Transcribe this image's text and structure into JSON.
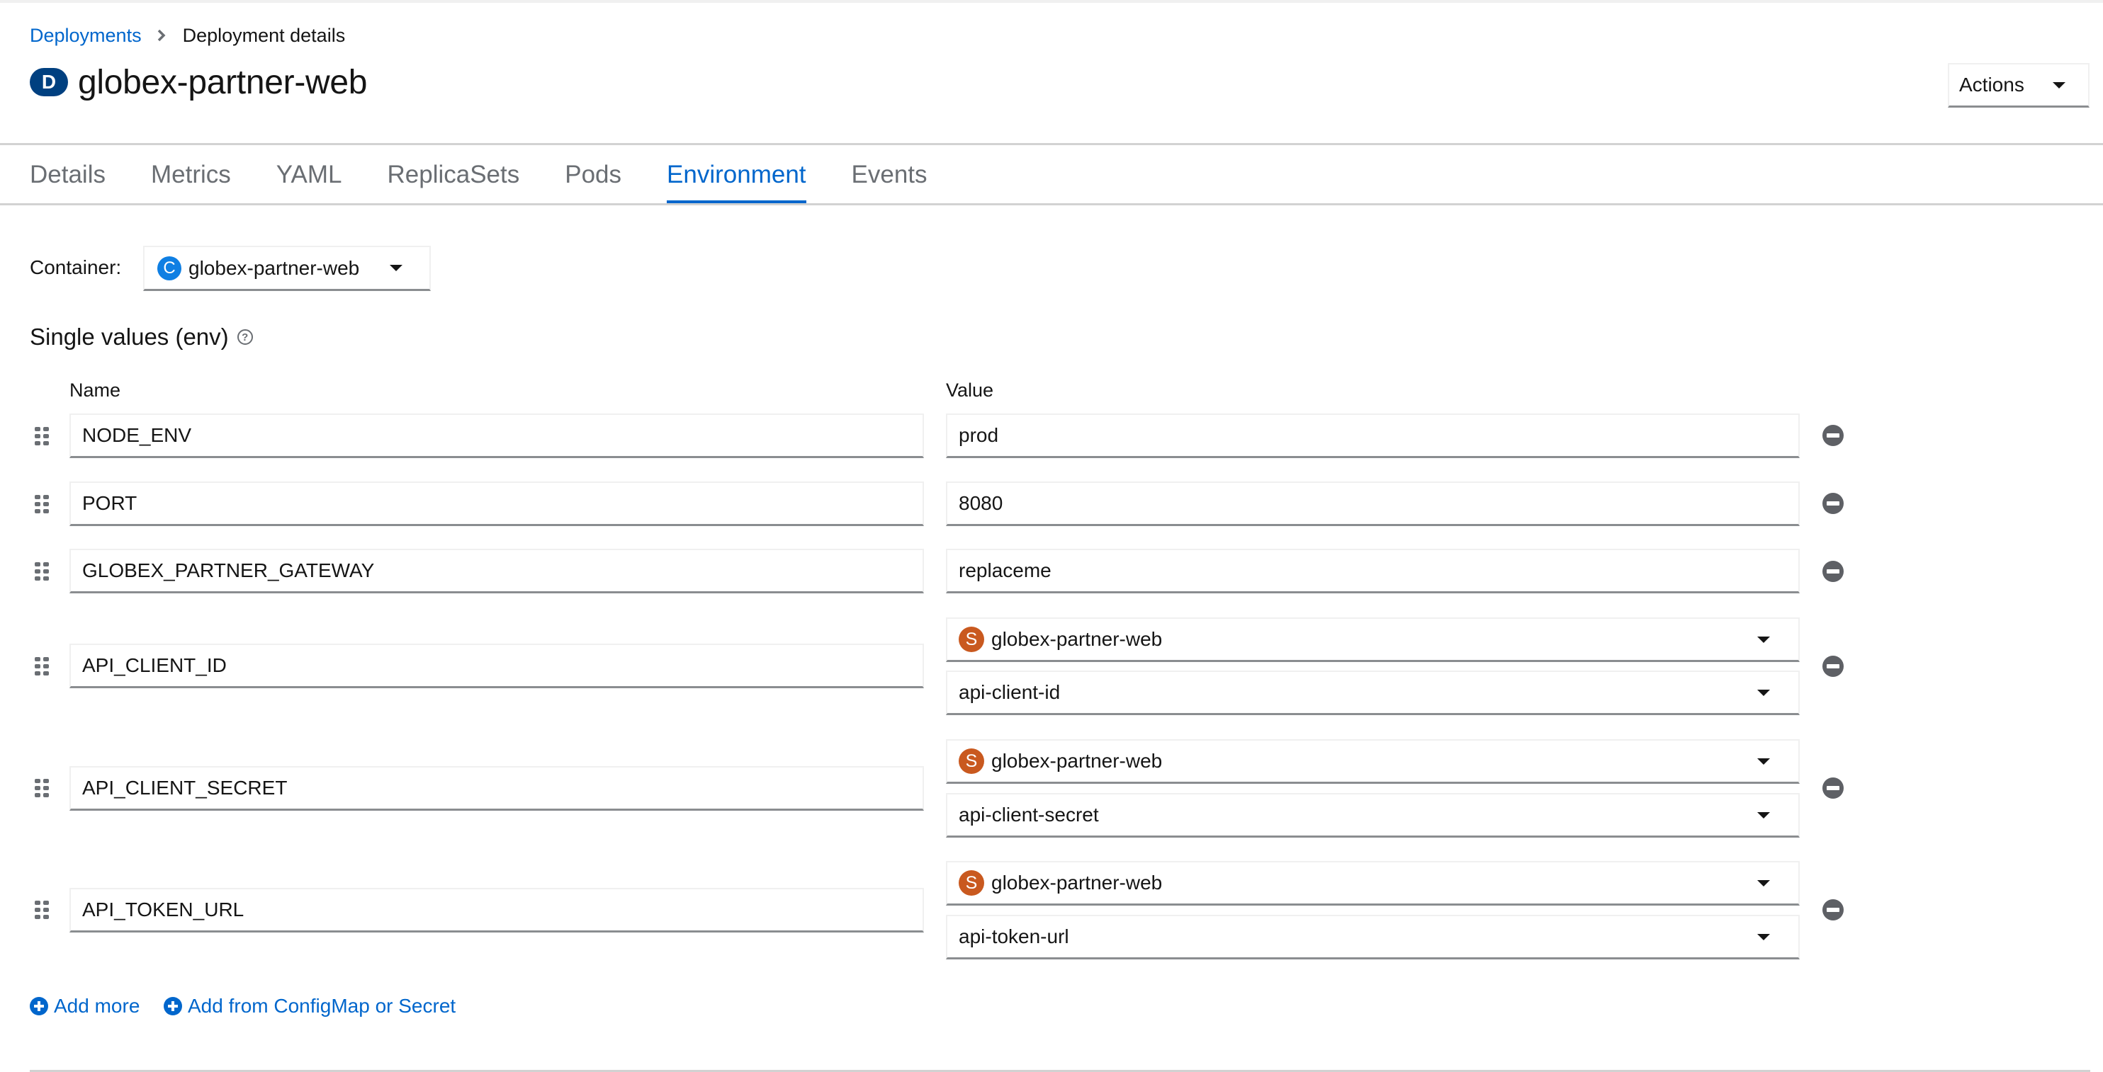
{
  "breadcrumb": {
    "items": [
      {
        "label": "Deployments",
        "link": true
      },
      {
        "label": "Deployment details",
        "link": false
      }
    ]
  },
  "header": {
    "resource_badge": "D",
    "title": "globex-partner-web",
    "actions_label": "Actions"
  },
  "tabs": [
    {
      "label": "Details",
      "active": false
    },
    {
      "label": "Metrics",
      "active": false
    },
    {
      "label": "YAML",
      "active": false
    },
    {
      "label": "ReplicaSets",
      "active": false
    },
    {
      "label": "Pods",
      "active": false
    },
    {
      "label": "Environment",
      "active": true
    },
    {
      "label": "Events",
      "active": false
    }
  ],
  "container": {
    "label": "Container:",
    "badge": "C",
    "selected": "globex-partner-web"
  },
  "env_section": {
    "title": "Single values (env)",
    "help_icon": "question-circle-icon",
    "name_header": "Name",
    "value_header": "Value",
    "rows": [
      {
        "name": "NODE_ENV",
        "type": "text",
        "value": "prod"
      },
      {
        "name": "PORT",
        "type": "text",
        "value": "8080"
      },
      {
        "name": "GLOBEX_PARTNER_GATEWAY",
        "type": "text",
        "value": "replaceme"
      },
      {
        "name": "API_CLIENT_ID",
        "type": "secret",
        "badge": "S",
        "resource": "globex-partner-web",
        "key": "api-client-id"
      },
      {
        "name": "API_CLIENT_SECRET",
        "type": "secret",
        "badge": "S",
        "resource": "globex-partner-web",
        "key": "api-client-secret"
      },
      {
        "name": "API_TOKEN_URL",
        "type": "secret",
        "badge": "S",
        "resource": "globex-partner-web",
        "key": "api-token-url"
      }
    ],
    "add_more_label": "Add more",
    "add_from_label": "Add from ConfigMap or Secret"
  },
  "colors": {
    "link": "#0066cc",
    "deployment_badge": "#004080",
    "container_badge": "#0f7fe3",
    "secret_badge": "#c9591f",
    "remove_icon": "#5e6065"
  }
}
